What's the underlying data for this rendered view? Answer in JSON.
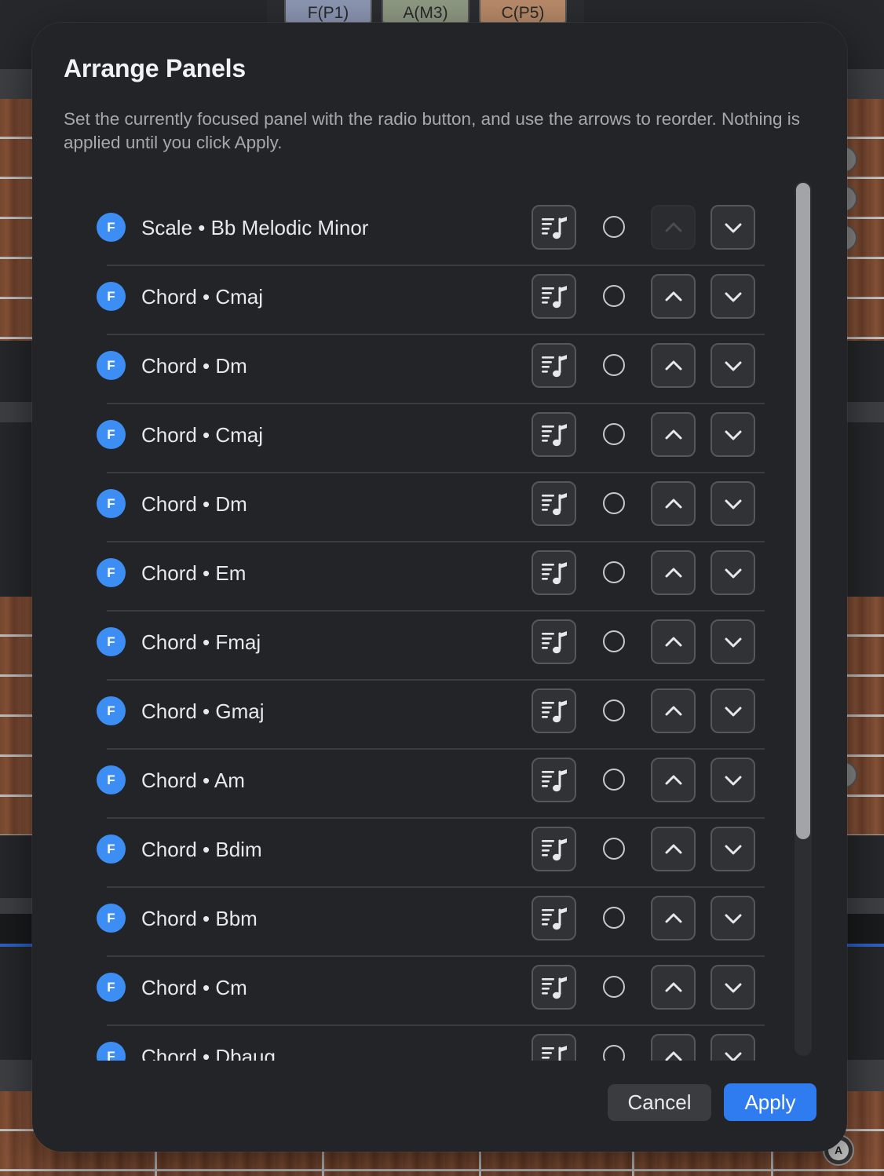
{
  "background": {
    "note_tabs": [
      {
        "label": "F(P1)",
        "color": "#8c97b3"
      },
      {
        "label": "A(M3)",
        "color": "#8f9a83"
      },
      {
        "label": "C(P5)",
        "color": "#b98b6a"
      }
    ],
    "knob_label": "A"
  },
  "dialog": {
    "title": "Arrange Panels",
    "description": "Set the currently focused panel with the radio button, and use the arrows to reorder. Nothing is applied until you click Apply.",
    "rows": [
      {
        "badge": "F",
        "label": "Scale • Bb Melodic Minor",
        "up_enabled": false
      },
      {
        "badge": "F",
        "label": "Chord • Cmaj",
        "up_enabled": true
      },
      {
        "badge": "F",
        "label": "Chord • Dm",
        "up_enabled": true
      },
      {
        "badge": "F",
        "label": "Chord • Cmaj",
        "up_enabled": true
      },
      {
        "badge": "F",
        "label": "Chord • Dm",
        "up_enabled": true
      },
      {
        "badge": "F",
        "label": "Chord • Em",
        "up_enabled": true
      },
      {
        "badge": "F",
        "label": "Chord • Fmaj",
        "up_enabled": true
      },
      {
        "badge": "F",
        "label": "Chord • Gmaj",
        "up_enabled": true
      },
      {
        "badge": "F",
        "label": "Chord • Am",
        "up_enabled": true
      },
      {
        "badge": "F",
        "label": "Chord • Bdim",
        "up_enabled": true
      },
      {
        "badge": "F",
        "label": "Chord • Bbm",
        "up_enabled": true
      },
      {
        "badge": "F",
        "label": "Chord • Cm",
        "up_enabled": true
      },
      {
        "badge": "F",
        "label": "Chord • Dbaug",
        "up_enabled": true
      }
    ],
    "cancel_label": "Cancel",
    "apply_label": "Apply"
  },
  "colors": {
    "accent": "#2f7bf0",
    "badge": "#3d8ef4",
    "dialog_bg": "#222427"
  }
}
